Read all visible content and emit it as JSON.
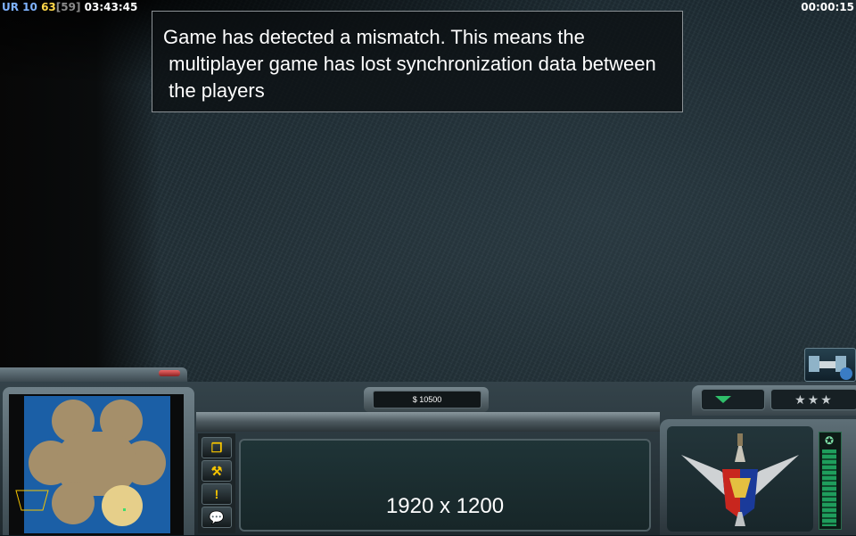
{
  "hud": {
    "faction": "UR",
    "value_blue": "10",
    "fps": "63",
    "fps_bracket": "[59]",
    "game_clock": "03:43:45",
    "timer": "00:00:15"
  },
  "message": {
    "text": "Game has detected a mismatch. This means the\n multiplayer game has lost synchronization data between\n the players"
  },
  "economy": {
    "money": "$ 10500"
  },
  "sidebar": {
    "buttons": [
      {
        "icon": "windows-icon"
      },
      {
        "icon": "wrench-hammer-icon"
      },
      {
        "icon": "alert-icon"
      },
      {
        "icon": "chat-icon"
      }
    ]
  },
  "build_panel": {
    "resolution_label": "1920 x 1200"
  },
  "rank": {
    "stars": "★★★"
  },
  "colors": {
    "money_text": "#ffffff",
    "button_icons": "#f5c400",
    "power_bar": "#1f9d5c"
  }
}
